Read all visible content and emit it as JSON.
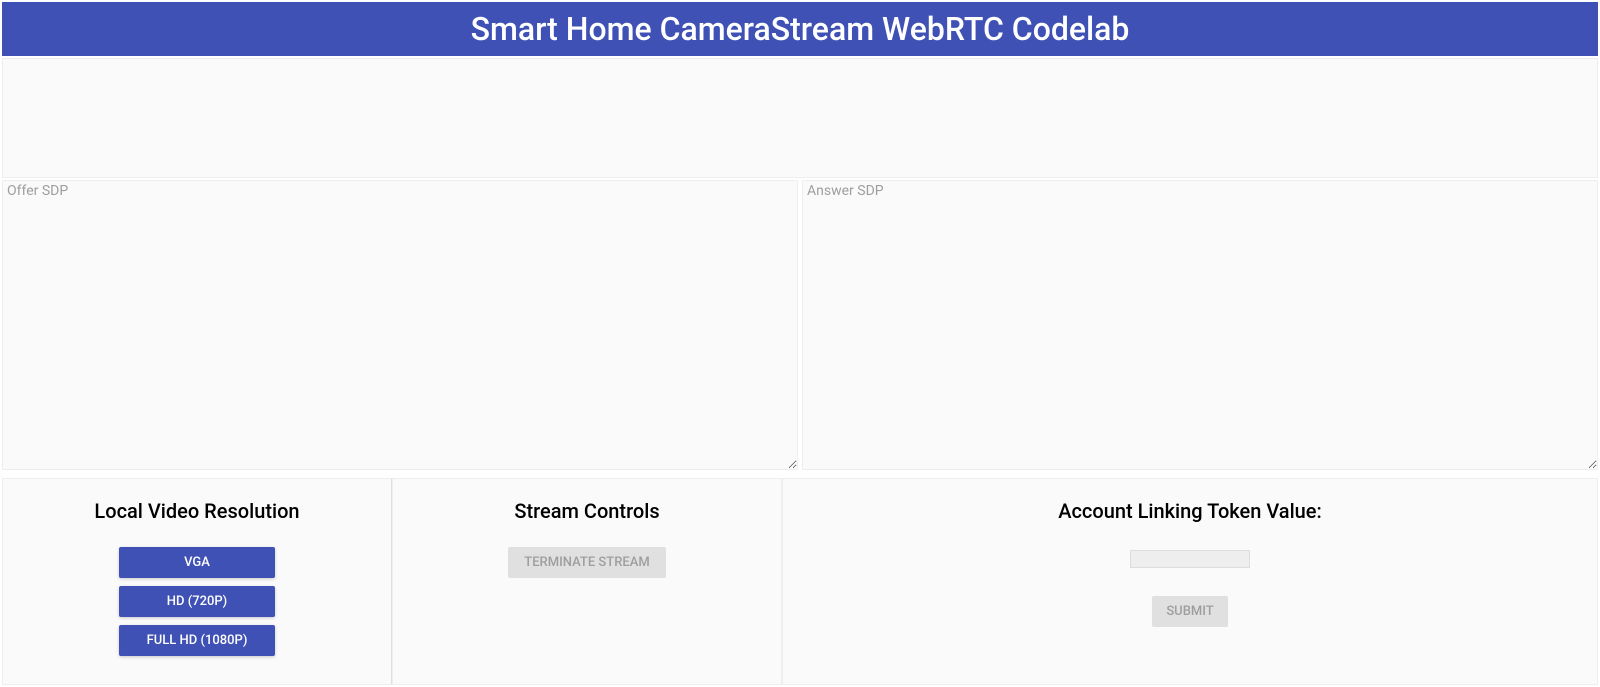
{
  "header": {
    "title": "Smart Home CameraStream WebRTC Codelab"
  },
  "sdp": {
    "offer_placeholder": "Offer SDP",
    "offer_value": "",
    "answer_placeholder": "Answer SDP",
    "answer_value": ""
  },
  "panels": {
    "resolution": {
      "title": "Local Video Resolution",
      "buttons": {
        "vga": "VGA",
        "hd": "HD (720P)",
        "fullhd": "FULL HD (1080P)"
      }
    },
    "stream": {
      "title": "Stream Controls",
      "terminate": "TERMINATE STREAM"
    },
    "token": {
      "title": "Account Linking Token Value:",
      "input_value": "",
      "submit": "SUBMIT"
    }
  }
}
